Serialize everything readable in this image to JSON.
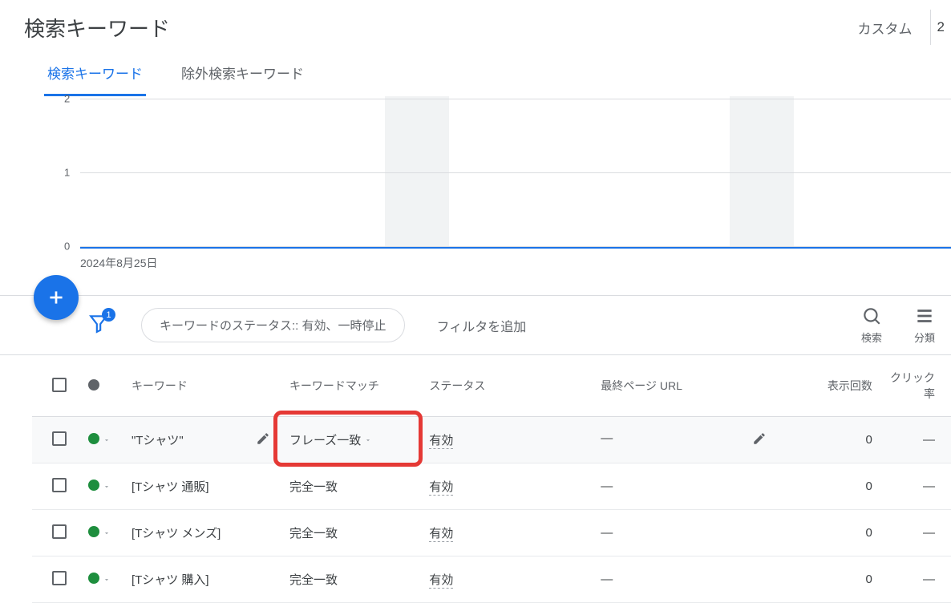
{
  "header": {
    "title": "検索キーワード",
    "custom_label": "カスタム",
    "edge_value": "2"
  },
  "tabs": [
    {
      "label": "検索キーワード",
      "active": true
    },
    {
      "label": "除外検索キーワード",
      "active": false
    }
  ],
  "chart_data": {
    "type": "line",
    "y_ticks": [
      "2",
      "1",
      "0"
    ],
    "date_label": "2024年8月25日",
    "series": [],
    "ylim": [
      0,
      2
    ]
  },
  "toolbar": {
    "filter_badge": "1",
    "filter_chip": "キーワードのステータス:: 有効、一時停止",
    "add_filter": "フィルタを追加",
    "search_label": "検索",
    "segment_label": "分類"
  },
  "table": {
    "columns": {
      "keyword": "キーワード",
      "match": "キーワードマッチ",
      "status": "ステータス",
      "final_url": "最終ページ URL",
      "impressions": "表示回数",
      "ctr": "クリック率"
    },
    "rows": [
      {
        "keyword": "\"Tシャツ\"",
        "match": "フレーズ一致",
        "status": "有効",
        "url": "—",
        "impressions": "0",
        "ctr": "—",
        "highlight": true,
        "hover": true
      },
      {
        "keyword": "[Tシャツ 通販]",
        "match": "完全一致",
        "status": "有効",
        "url": "—",
        "impressions": "0",
        "ctr": "—"
      },
      {
        "keyword": "[Tシャツ メンズ]",
        "match": "完全一致",
        "status": "有効",
        "url": "—",
        "impressions": "0",
        "ctr": "—"
      },
      {
        "keyword": "[Tシャツ 購入]",
        "match": "完全一致",
        "status": "有効",
        "url": "—",
        "impressions": "0",
        "ctr": "—"
      }
    ]
  }
}
